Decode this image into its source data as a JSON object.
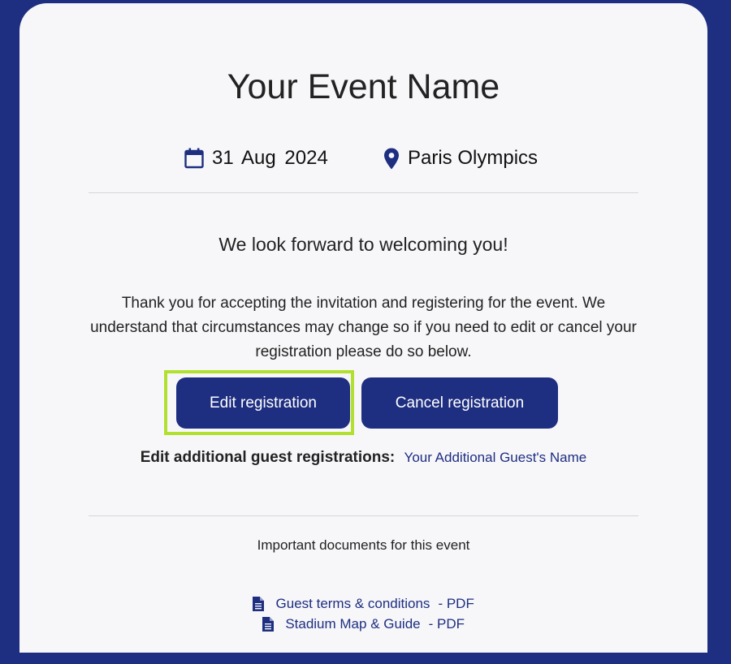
{
  "event": {
    "title": "Your Event Name",
    "date": "31 Aug 2024",
    "location": "Paris Olympics"
  },
  "welcome": "We look forward to welcoming you!",
  "message": "Thank you for accepting the invitation and registering for the event. We understand that circumstances may change so if you need to edit or cancel your registration please do so below.",
  "buttons": {
    "edit": "Edit registration",
    "cancel": "Cancel registration"
  },
  "guests": {
    "label": "Edit additional guest registrations:",
    "items": [
      "Your Additional Guest's Name"
    ]
  },
  "documents": {
    "title": "Important documents for this event",
    "items": [
      {
        "name": "Guest terms & conditions",
        "format": "- PDF"
      },
      {
        "name": "Stadium Map & Guide",
        "format": "- PDF"
      }
    ]
  },
  "colors": {
    "brand": "#1e2e80",
    "highlight": "#b2e02e",
    "card": "#f7f7fa"
  },
  "icons": [
    "calendar-icon",
    "map-pin-icon",
    "file-icon"
  ]
}
